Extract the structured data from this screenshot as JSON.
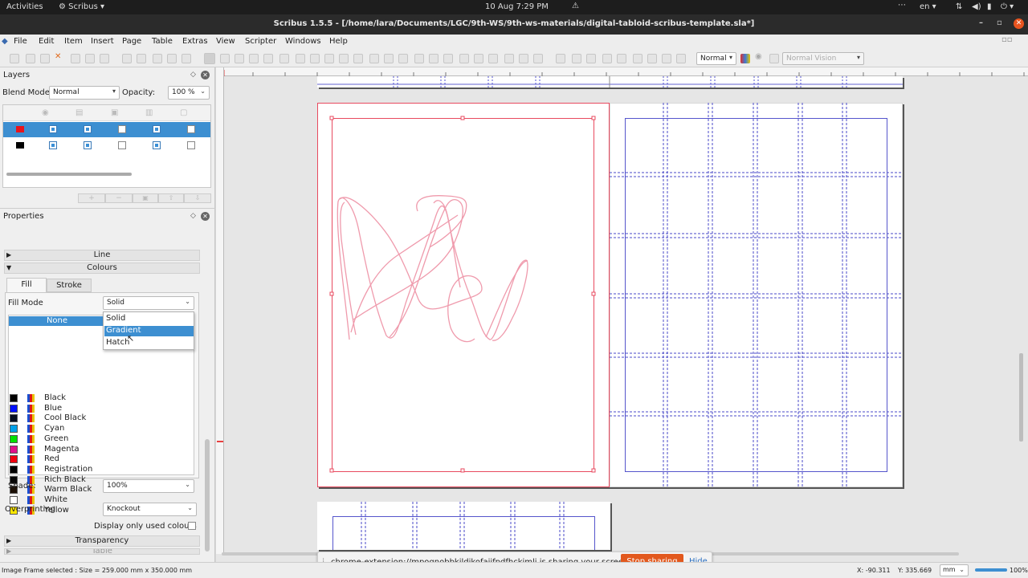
{
  "system_bar": {
    "activities": "Activities",
    "app": "Scribus",
    "datetime": "10 Aug  7:29 PM",
    "lang": "en"
  },
  "window": {
    "title": "Scribus 1.5.5 - [/home/lara/Documents/LGC/9th-WS/9th-ws-materials/digital-tabloid-scribus-template.sla*]"
  },
  "menu": [
    "File",
    "Edit",
    "Item",
    "Insert",
    "Page",
    "Table",
    "Extras",
    "View",
    "Scripter",
    "Windows",
    "Help"
  ],
  "toolbar": {
    "mode_value": "Normal",
    "vision_value": "Normal Vision"
  },
  "layers_panel": {
    "title": "Layers",
    "blend_label": "Blend Mode:",
    "blend_value": "Normal",
    "opacity_label": "Opacity:",
    "opacity_value": "100 %",
    "layers": [
      {
        "color": "#e8141c",
        "selected": true,
        "visible": true,
        "print": true,
        "lock": false,
        "flow": true,
        "outline": false
      },
      {
        "color": "#000000",
        "selected": false,
        "visible": true,
        "print": true,
        "lock": false,
        "flow": true,
        "outline": false
      }
    ]
  },
  "properties_panel": {
    "title": "Properties",
    "line_section": "Line",
    "colours_section": "Colours",
    "tab_fill": "Fill",
    "tab_stroke": "Stroke",
    "fill_mode_label": "Fill Mode",
    "fill_mode_value": "Solid",
    "fill_mode_options": [
      "Solid",
      "Gradient",
      "Hatch"
    ],
    "fill_mode_highlighted": "Gradient",
    "colour_none": "None",
    "colours": [
      {
        "name": "Black",
        "swatch": "#000000"
      },
      {
        "name": "Blue",
        "swatch": "#0010ff"
      },
      {
        "name": "Cool Black",
        "swatch": "#081020"
      },
      {
        "name": "Cyan",
        "swatch": "#00a0e8"
      },
      {
        "name": "Green",
        "swatch": "#00e000"
      },
      {
        "name": "Magenta",
        "swatch": "#e0108a"
      },
      {
        "name": "Red",
        "swatch": "#f00010"
      },
      {
        "name": "Registration",
        "swatch": "#000000"
      },
      {
        "name": "Rich Black",
        "swatch": "#050505"
      },
      {
        "name": "Warm Black",
        "swatch": "#1a0f05"
      },
      {
        "name": "White",
        "swatch": "#ffffff"
      },
      {
        "name": "Yellow",
        "swatch": "#ffe800"
      }
    ],
    "shade_label": "Shade:",
    "shade_value": "100%",
    "overprint_label": "Overprinting",
    "overprint_value": "Knockout",
    "display_used_label": "Display only used colours",
    "transparency_section": "Transparency",
    "table_section": "Table"
  },
  "share_notice": {
    "text": "chrome-extension://mpognobbkildjkofajifpdfhckimli is sharing your screen.",
    "stop_label": "Stop sharing",
    "hide_label": "Hide"
  },
  "status": {
    "selection": "Image Frame selected : Size = 259.000 mm x 350.000 mm",
    "x": "X: -90.311",
    "y": "Y: 335.669",
    "unit": "mm",
    "zoom": "100%"
  },
  "colors": {
    "accent": "#3d8fd1",
    "stop_button": "#e2581d",
    "bleed_red": "#e84a5f"
  }
}
